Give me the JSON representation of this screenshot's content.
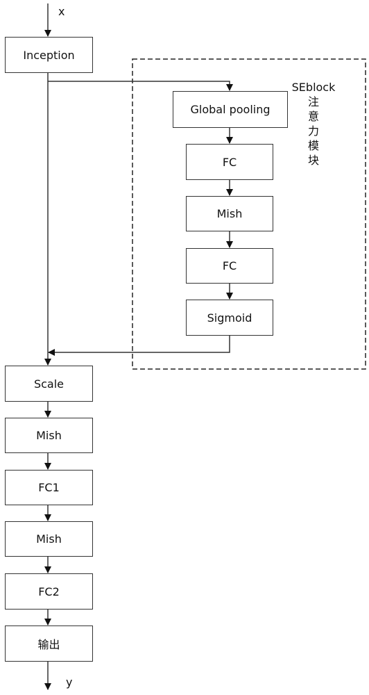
{
  "input_label": "x",
  "output_label": "y",
  "main_blocks": [
    "Inception",
    "Scale",
    "Mish",
    "FC1",
    "Mish",
    "FC2",
    "输出"
  ],
  "se_block": {
    "title": "SEblock",
    "subtitle_chars": [
      "注",
      "意",
      "力",
      "模",
      "块"
    ],
    "blocks": [
      "Global pooling",
      "FC",
      "Mish",
      "FC",
      "Sigmoid"
    ]
  }
}
